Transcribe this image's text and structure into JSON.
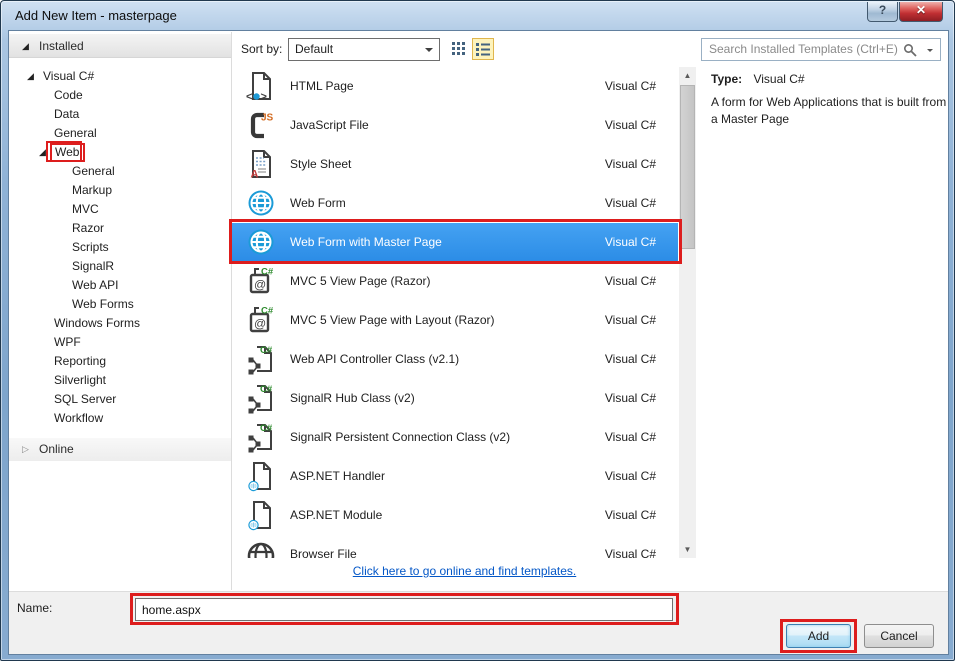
{
  "window": {
    "title": "Add New Item - masterpage",
    "help_glyph": "?",
    "close_glyph": "✕"
  },
  "sidebar": {
    "installed_header": "Installed",
    "online_header": "Online",
    "tree": [
      {
        "label": "Visual C#",
        "level": 0,
        "expanded": true,
        "has_children": true
      },
      {
        "label": "Code",
        "level": 1
      },
      {
        "label": "Data",
        "level": 1
      },
      {
        "label": "General",
        "level": 1
      },
      {
        "label": "Web",
        "level": 1,
        "expanded": true,
        "has_children": true,
        "annotated": true
      },
      {
        "label": "General",
        "level": 2
      },
      {
        "label": "Markup",
        "level": 2
      },
      {
        "label": "MVC",
        "level": 2
      },
      {
        "label": "Razor",
        "level": 2
      },
      {
        "label": "Scripts",
        "level": 2
      },
      {
        "label": "SignalR",
        "level": 2
      },
      {
        "label": "Web API",
        "level": 2
      },
      {
        "label": "Web Forms",
        "level": 2
      },
      {
        "label": "Windows Forms",
        "level": 1
      },
      {
        "label": "WPF",
        "level": 1
      },
      {
        "label": "Reporting",
        "level": 1
      },
      {
        "label": "Silverlight",
        "level": 1
      },
      {
        "label": "SQL Server",
        "level": 1
      },
      {
        "label": "Workflow",
        "level": 1
      }
    ]
  },
  "toolbar": {
    "sort_by_label": "Sort by:",
    "sort_value": "Default"
  },
  "search": {
    "placeholder": "Search Installed Templates (Ctrl+E)"
  },
  "templates": [
    {
      "name": "HTML Page",
      "language": "Visual C#",
      "icon": "html-page"
    },
    {
      "name": "JavaScript File",
      "language": "Visual C#",
      "icon": "javascript-file"
    },
    {
      "name": "Style Sheet",
      "language": "Visual C#",
      "icon": "style-sheet"
    },
    {
      "name": "Web Form",
      "language": "Visual C#",
      "icon": "web-form"
    },
    {
      "name": "Web Form with Master Page",
      "language": "Visual C#",
      "icon": "web-form",
      "selected": true
    },
    {
      "name": "MVC 5 View Page (Razor)",
      "language": "Visual C#",
      "icon": "razor-page"
    },
    {
      "name": "MVC 5 View Page with Layout (Razor)",
      "language": "Visual C#",
      "icon": "razor-page"
    },
    {
      "name": "Web API Controller Class (v2.1)",
      "language": "Visual C#",
      "icon": "code-class"
    },
    {
      "name": "SignalR Hub Class (v2)",
      "language": "Visual C#",
      "icon": "code-class"
    },
    {
      "name": "SignalR Persistent Connection Class (v2)",
      "language": "Visual C#",
      "icon": "code-class"
    },
    {
      "name": "ASP.NET Handler",
      "language": "Visual C#",
      "icon": "aspnet-file"
    },
    {
      "name": "ASP.NET Module",
      "language": "Visual C#",
      "icon": "aspnet-file"
    },
    {
      "name": "Browser File",
      "language": "Visual C#",
      "icon": "browser-file",
      "clipped": true
    }
  ],
  "online_link": "Click here to go online and find templates.",
  "info": {
    "type_label": "Type:",
    "type_value": "Visual C#",
    "description": "A form for Web Applications that is built from a Master Page"
  },
  "footer": {
    "name_label": "Name:",
    "name_value": "home.aspx",
    "add_label": "Add",
    "cancel_label": "Cancel"
  },
  "colors": {
    "selection": "#3394ec",
    "annotation": "#dd1d1d",
    "link": "#0457c7"
  }
}
